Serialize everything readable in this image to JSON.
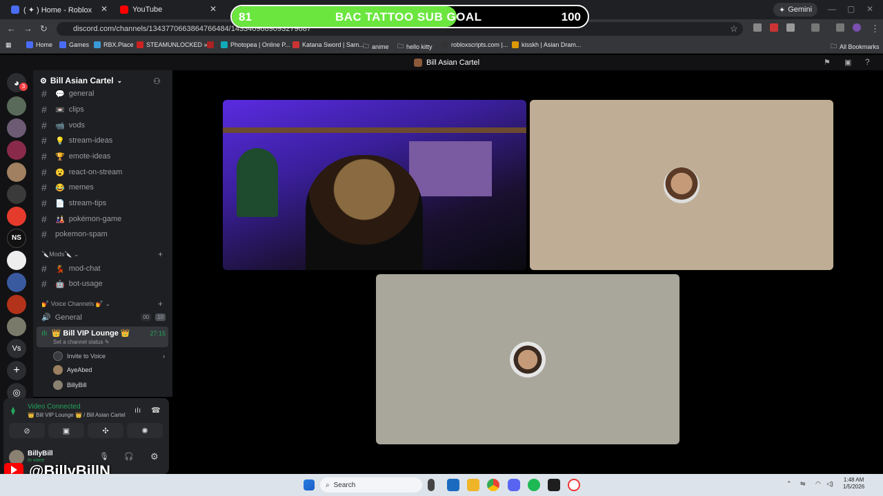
{
  "browser": {
    "tabs": [
      {
        "title": "( ✦ ) Home - Roblox"
      },
      {
        "title": "YouTube"
      }
    ],
    "gemini_label": "Gemini",
    "url": "discord.com/channels/1343770663864766484/1433409689093279687",
    "bookmarks": [
      "Home",
      "Games",
      "RBX.Place",
      "STEAMUNLOCKED »...",
      "Photopea | Online P...",
      "Katana Sword | Sam...",
      "anime",
      "hello kitty",
      "robloxscripts.com |...",
      "kisskh | Asian Dram..."
    ],
    "all_bookmarks": "All Bookmarks"
  },
  "goal": {
    "start": "81",
    "title": "BAC TATTOO SUB GOAL",
    "end": "100",
    "progress": 0.81,
    "fill_color": "#6be63f"
  },
  "discord": {
    "top_title": "Bill Asian Cartel",
    "rail_badge": "3",
    "server_name": "Bill Asian Cartel",
    "channels": [
      {
        "name": "general",
        "emoji": "💬"
      },
      {
        "name": "clips",
        "emoji": "📼"
      },
      {
        "name": "vods",
        "emoji": "📹"
      },
      {
        "name": "stream-ideas",
        "emoji": "💡"
      },
      {
        "name": "emote-ideas",
        "emoji": "🏆"
      },
      {
        "name": "react-on-stream",
        "emoji": "😮"
      },
      {
        "name": "memes",
        "emoji": "😂"
      },
      {
        "name": "stream-tips",
        "emoji": "📄"
      },
      {
        "name": "pokémon-game",
        "emoji": "🎎"
      },
      {
        "name": "pokemon-spam",
        "emoji": ""
      }
    ],
    "mods_category": "🔪Mods🔪",
    "mod_channels": [
      {
        "name": "mod-chat",
        "emoji": "💃"
      },
      {
        "name": "bot-usage",
        "emoji": "🤖"
      }
    ],
    "voice_category": "💅 Voice Channels 💅",
    "voice_general": {
      "name": "General",
      "count_a": "00",
      "count_b": "10"
    },
    "voice_vip": {
      "name": "👑 Bill VIP Lounge 👑",
      "timer": "27:15",
      "status": "Set a channel status"
    },
    "invite": "Invite to Voice",
    "members": [
      "AyeAbed",
      "BillyBill"
    ],
    "voice_panel": {
      "status": "Video Connected",
      "location": "👑 Bill VIP Lounge 👑 / Bill Asian Cartel",
      "status_color": "#23a55a"
    },
    "user": {
      "name": "BillyBill",
      "status": "In voice"
    }
  },
  "overlay": {
    "handle": "@BillyBillN"
  },
  "taskbar": {
    "search": "Search",
    "time": "1:48 AM",
    "date": "1/5/2026"
  }
}
